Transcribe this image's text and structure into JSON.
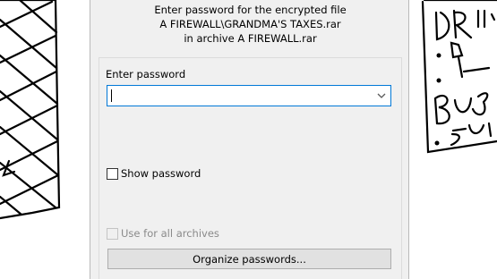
{
  "dialog": {
    "prompt_line1": "Enter password for the encrypted file",
    "prompt_line2": "A FIREWALL\\GRANDMA'S TAXES.rar",
    "prompt_line3": "in archive A FIREWALL.rar",
    "password_label": "Enter password",
    "password_value": "",
    "show_password_label": "Show password",
    "show_password_checked": false,
    "use_all_label": "Use for all archives",
    "use_all_enabled": false,
    "organize_button": "Organize passwords..."
  },
  "icons": {
    "combo_arrow": "chevron-down-icon"
  },
  "colors": {
    "dialog_bg": "#f0f0f0",
    "focus_border": "#0078d7",
    "button_bg": "#e1e1e1",
    "disabled_text": "#8a8a8a"
  }
}
